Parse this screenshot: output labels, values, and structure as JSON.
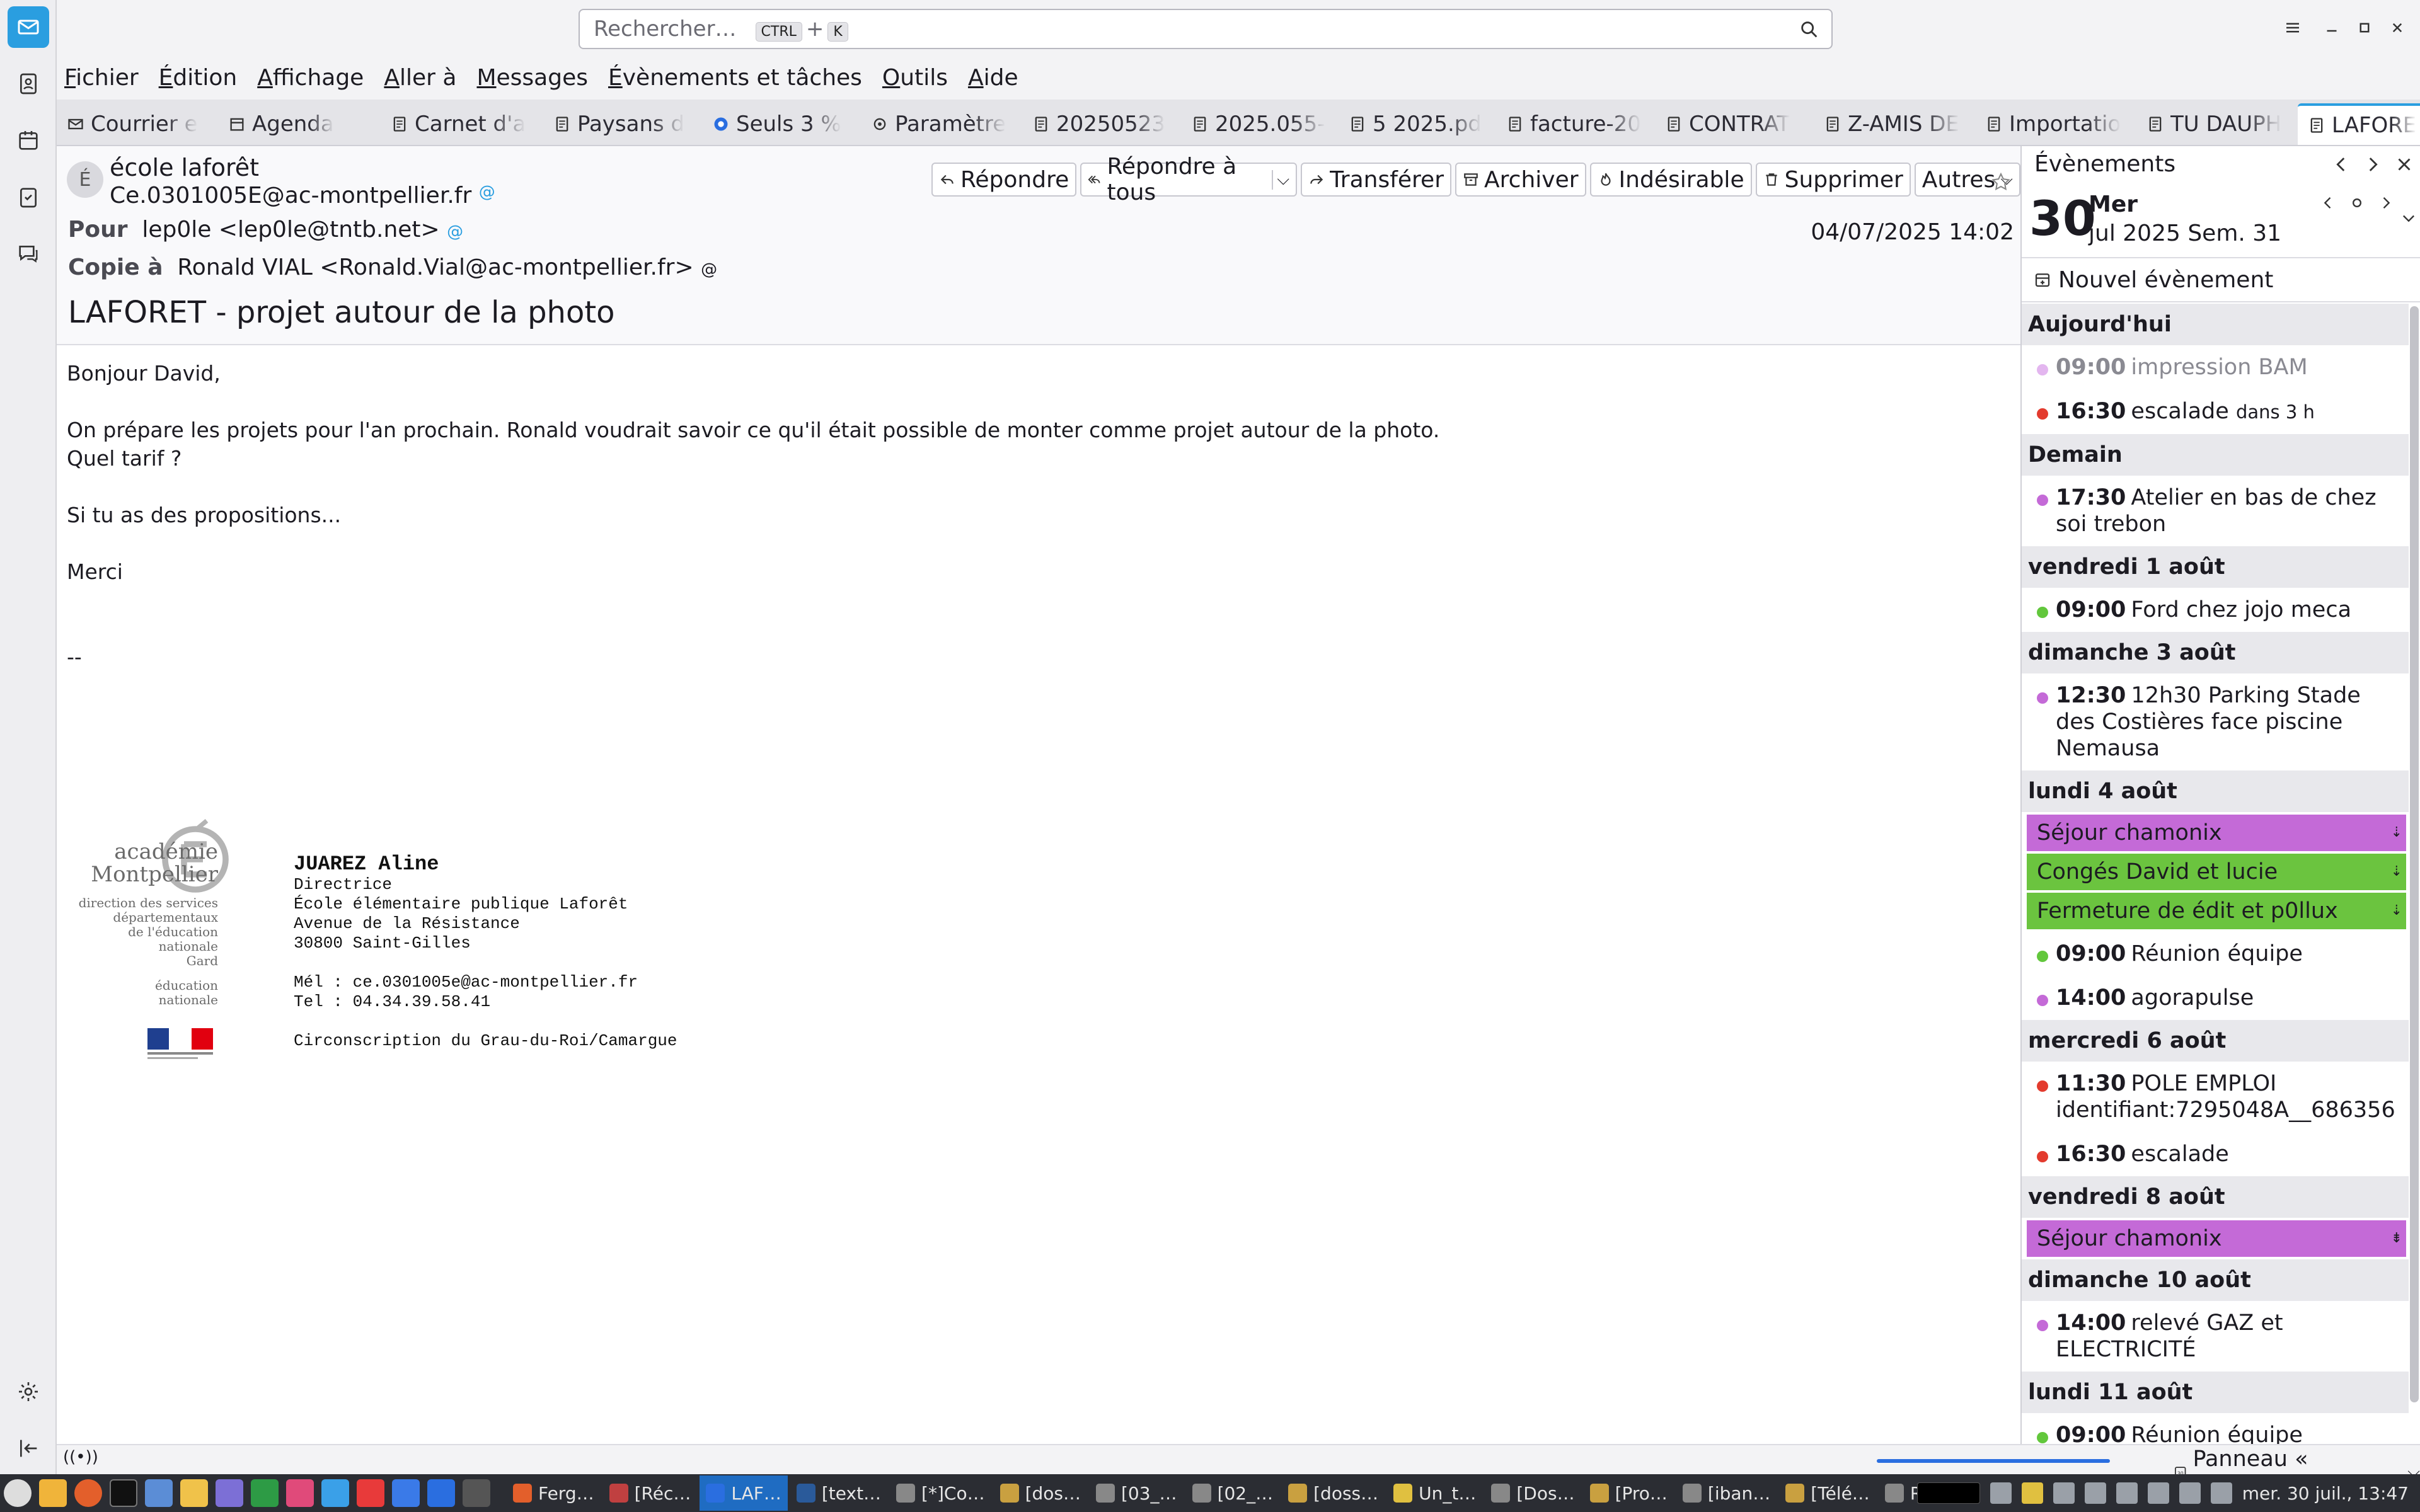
{
  "search": {
    "placeholder": "Rechercher…",
    "key1": "CTRL",
    "plus": "+",
    "key2": "K"
  },
  "menu": [
    "Fichier",
    "Édition",
    "Affichage",
    "Aller à",
    "Messages",
    "Évènements et tâches",
    "Outils",
    "Aide"
  ],
  "tabs": [
    {
      "label": "Courrier e",
      "icon": "mail-icon"
    },
    {
      "label": "Agenda",
      "icon": "calendar-icon"
    },
    {
      "label": "Carnet d'a",
      "icon": "address-book-icon"
    },
    {
      "label": "Paysans d",
      "icon": "message-icon"
    },
    {
      "label": "Seuls 3 %",
      "icon": "firefox-icon"
    },
    {
      "label": "Paramètre",
      "icon": "settings-icon"
    },
    {
      "label": "20250523",
      "icon": "message-icon"
    },
    {
      "label": "2025.055-",
      "icon": "message-icon"
    },
    {
      "label": "5 2025.pd",
      "icon": "message-icon"
    },
    {
      "label": "facture-20",
      "icon": "message-icon"
    },
    {
      "label": "CONTRAT",
      "icon": "message-icon"
    },
    {
      "label": "Z-AMIS DE",
      "icon": "message-icon"
    },
    {
      "label": "Importatio",
      "icon": "message-icon"
    },
    {
      "label": "TU DAUPH",
      "icon": "message-icon"
    },
    {
      "label": "LAFORE",
      "icon": "message-icon"
    }
  ],
  "message": {
    "avatar_letter": "É",
    "from_name": "école laforêt",
    "from_addr": "Ce.0301005E@ac-montpellier.fr",
    "to_label": "Pour",
    "to": "lep0le <lep0le@tntb.net>",
    "cc_label": "Copie à",
    "cc": "Ronald VIAL <Ronald.Vial@ac-montpellier.fr>",
    "date": "04/07/2025 14:02",
    "subject": "LAFORET - projet autour de la photo",
    "actions": {
      "reply": "Répondre",
      "reply_all": "Répondre à tous",
      "forward": "Transférer",
      "archive": "Archiver",
      "junk": "Indésirable",
      "delete": "Supprimer",
      "more": "Autres"
    },
    "body": [
      "Bonjour David,",
      "",
      "On prépare les projets pour l'an prochain. Ronald voudrait savoir ce qu'il était possible de monter comme projet autour de la photo.",
      "Quel tarif ?",
      "",
      "Si tu as des propositions...",
      "",
      "Merci",
      "",
      "",
      "--"
    ],
    "signature": {
      "logo_lines": [
        "académie",
        "Montpellier",
        "direction des services",
        "départementaux",
        "de l'éducation nationale",
        "Gard",
        "éducation",
        "nationale"
      ],
      "name": "JUAREZ Aline",
      "lines": [
        "Directrice",
        "École élémentaire publique Laforêt",
        "Avenue de la Résistance",
        "30800 Saint-Gilles",
        "",
        "Mél : ce.0301005e@ac-montpellier.fr",
        "Tel : 04.34.39.58.41",
        "",
        "Circonscription du Grau-du-Roi/Camargue"
      ]
    }
  },
  "events_panel": {
    "title": "Évènements",
    "day_number": "30",
    "day_name": "Mer",
    "month_week": "jul 2025 Sem. 31",
    "new_event": "Nouvel évènement",
    "groups": [
      {
        "day": "Aujourd'hui",
        "items": [
          {
            "type": "timed",
            "time": "09:00",
            "title": "impression BAM",
            "color": "#e3b6ef",
            "past": true
          },
          {
            "type": "timed",
            "time": "16:30",
            "title": "escalade",
            "extra": "dans 3 h",
            "color": "#e33b2e"
          }
        ]
      },
      {
        "day": "Demain",
        "items": [
          {
            "type": "timed",
            "time": "17:30",
            "title": "Atelier en bas de chez soi trebon",
            "color": "#c46ad7"
          }
        ]
      },
      {
        "day": "vendredi 1 août",
        "items": [
          {
            "type": "timed",
            "time": "09:00",
            "title": "Ford chez jojo meca",
            "color": "#62c73c"
          }
        ]
      },
      {
        "day": "dimanche 3 août",
        "items": [
          {
            "type": "timed",
            "time": "12:30",
            "title": "12h30 Parking Stade des Costières face piscine Nemausa",
            "color": "#c46ad7"
          }
        ]
      },
      {
        "day": "lundi 4 août",
        "items": [
          {
            "type": "allday",
            "title": "Séjour chamonix",
            "color": "#c46ad7",
            "arrow": "⇣"
          },
          {
            "type": "allday",
            "title": "Congés David et lucie",
            "color": "#6bc43f",
            "arrow": "⇣"
          },
          {
            "type": "allday",
            "title": "Fermeture de édit et p0llux",
            "color": "#6bc43f",
            "arrow": "⇣"
          },
          {
            "type": "timed",
            "time": "09:00",
            "title": "Réunion équipe",
            "color": "#62c73c"
          },
          {
            "type": "timed",
            "time": "14:00",
            "title": "agorapulse",
            "color": "#c46ad7"
          }
        ]
      },
      {
        "day": "mercredi 6 août",
        "items": [
          {
            "type": "timed",
            "time": "11:30",
            "title": "POLE EMPLOI identifiant:7295048A__686356",
            "color": "#e33b2e"
          },
          {
            "type": "timed",
            "time": "16:30",
            "title": "escalade",
            "color": "#e33b2e"
          }
        ]
      },
      {
        "day": "vendredi 8 août",
        "items": [
          {
            "type": "allday",
            "title": "Séjour chamonix",
            "color": "#c46ad7",
            "arrow": "⇟"
          }
        ]
      },
      {
        "day": "dimanche 10 août",
        "items": [
          {
            "type": "timed",
            "time": "14:00",
            "title": "relevé GAZ et ELECTRICITÉ",
            "color": "#c46ad7"
          }
        ]
      },
      {
        "day": "lundi 11 août",
        "items": [
          {
            "type": "timed",
            "time": "09:00",
            "title": "Réunion équipe",
            "color": "#62c73c"
          }
        ]
      }
    ]
  },
  "status": {
    "panel_label": "Panneau « Aujourd'hui »",
    "panel_icon_text": "30"
  },
  "taskbar": {
    "tasks": [
      "Ferg…",
      "[Réc…",
      "LAF…",
      "[text…",
      "[*]Co…",
      "[dos…",
      "[03_…",
      "[02_…",
      "[doss…",
      "Un_t…",
      "[Dos…",
      "[Pro…",
      "[iban…",
      "[Télé…",
      "Réda…"
    ],
    "active_task": "LAF…",
    "clock": "mer. 30 juil., 13:47"
  },
  "colors": {
    "accent": "#2a9ee0",
    "purple": "#c46ad7",
    "green": "#6bc43f",
    "red": "#e33b2e"
  }
}
